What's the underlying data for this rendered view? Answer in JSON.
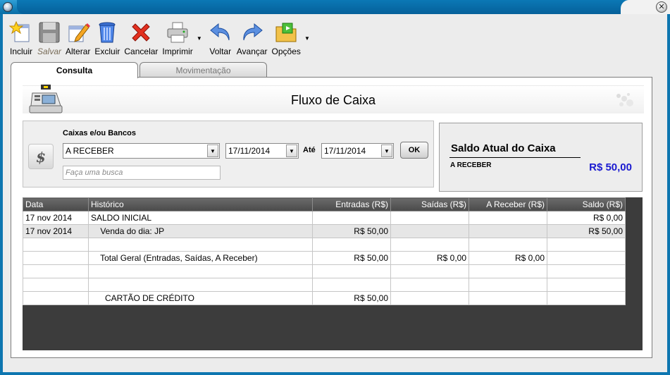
{
  "toolbar": {
    "items": [
      {
        "label": "Incluir",
        "icon": "add-star-icon"
      },
      {
        "label": "Salvar",
        "icon": "floppy-icon",
        "disabled": true
      },
      {
        "label": "Alterar",
        "icon": "edit-pencil-icon"
      },
      {
        "label": "Excluir",
        "icon": "trash-icon"
      },
      {
        "label": "Cancelar",
        "icon": "red-x-icon"
      },
      {
        "label": "Imprimir",
        "icon": "printer-icon"
      },
      {
        "label": "Voltar",
        "icon": "arrow-back-icon"
      },
      {
        "label": "Avançar",
        "icon": "arrow-forward-icon"
      },
      {
        "label": "Opções",
        "icon": "options-folder-icon"
      }
    ]
  },
  "tabs": [
    {
      "label": "Consulta",
      "active": true
    },
    {
      "label": "Movimentação",
      "active": false
    }
  ],
  "header": {
    "title": "Fluxo de Caixa"
  },
  "filter": {
    "label": "Caixas e/ou Bancos",
    "account_value": "A RECEBER",
    "date_from": "17/11/2014",
    "until_label": "Até",
    "date_to": "17/11/2014",
    "ok_label": "OK",
    "search_placeholder": "Faça uma busca"
  },
  "saldo": {
    "title": "Saldo Atual do Caixa",
    "account": "A RECEBER",
    "value": "R$ 50,00"
  },
  "grid": {
    "columns": [
      "Data",
      "Histórico",
      "Entradas (R$)",
      "Saídas (R$)",
      "A Receber (R$)",
      "Saldo (R$)"
    ],
    "rows": [
      [
        "17 nov 2014",
        "SALDO INICIAL",
        "",
        "",
        "",
        "R$ 0,00"
      ],
      [
        "17 nov 2014",
        "    Venda do dia: JP",
        "R$ 50,00",
        "",
        "",
        "R$ 50,00"
      ],
      [
        "",
        "",
        "",
        "",
        "",
        ""
      ],
      [
        "",
        "    Total Geral (Entradas, Saídas, A Receber)",
        "R$ 50,00",
        "R$ 0,00",
        "R$ 0,00",
        ""
      ],
      [
        "",
        "",
        "",
        "",
        "",
        ""
      ],
      [
        "",
        "",
        "",
        "",
        "",
        ""
      ],
      [
        "",
        "      CARTÃO DE CRÉDITO",
        "R$ 50,00",
        "",
        "",
        ""
      ]
    ]
  },
  "colors": {
    "titlebar": "#137fb8",
    "saldo_value": "#1a1ad0",
    "grid_header": "#5a5a5a",
    "grid_bg": "#3c3c3c"
  }
}
